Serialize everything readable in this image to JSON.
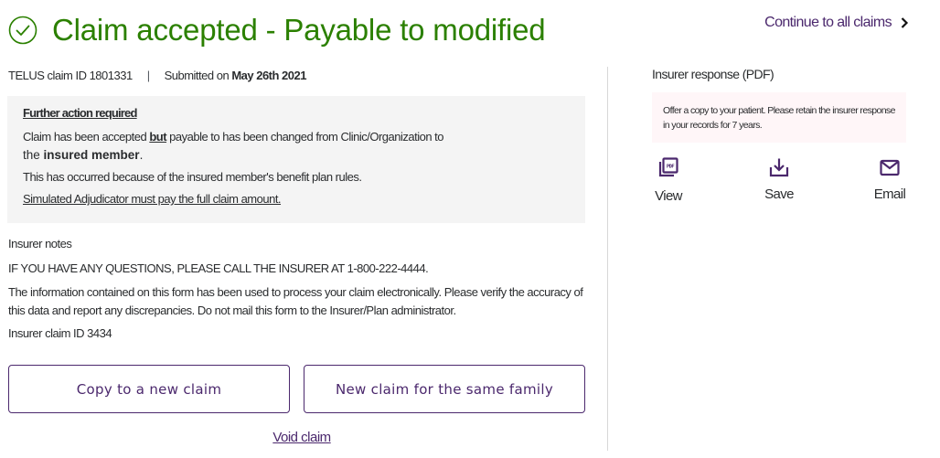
{
  "header": {
    "status_icon": "check-circle-icon",
    "title": "Claim accepted - Payable to modified",
    "continue_link": "Continue to all claims",
    "continue_icon": "chevron-right-icon",
    "colors": {
      "success": "#2b8000",
      "brand": "#4b286d"
    }
  },
  "meta": {
    "claim_id_label": "TELUS claim ID 1801331",
    "separator": "|",
    "submitted_label": "Submitted on",
    "submitted_date": "May 26th 2021"
  },
  "action_box": {
    "heading": "Further action required",
    "p1_before": "Claim has been accepted ",
    "p1_bold": "but",
    "p1_after": " payable to has been changed from Clinic/Organization to",
    "p1_line2_before": "the ",
    "p1_line2_bold": "insured member",
    "p1_line2_after": ".",
    "p2": "This has occurred because of the insured member's benefit plan rules.",
    "p3": "Simulated Adjudicator must pay the full claim amount."
  },
  "notes": {
    "label": "Insurer notes",
    "line1": "IF YOU HAVE ANY QUESTIONS, PLEASE CALL THE INSURER AT 1-800-222-4444.",
    "para": "The information contained on this form has been used to process your claim electronically. Please verify the accuracy of this data and report any discrepancies. Do not mail this form to the Insurer/Plan administrator.",
    "claim_id": "Insurer claim ID 3434"
  },
  "buttons": {
    "copy": "Copy to a new claim",
    "family": "New claim for the same family",
    "void": "Void claim"
  },
  "pdf": {
    "title": "Insurer response (PDF)",
    "note": "Offer a copy to your patient. Please retain the insurer response in your records for 7 years.",
    "actions": [
      {
        "label": "View",
        "icon": "pdf-file-icon"
      },
      {
        "label": "Save",
        "icon": "download-icon"
      },
      {
        "label": "Email",
        "icon": "envelope-icon"
      }
    ]
  }
}
